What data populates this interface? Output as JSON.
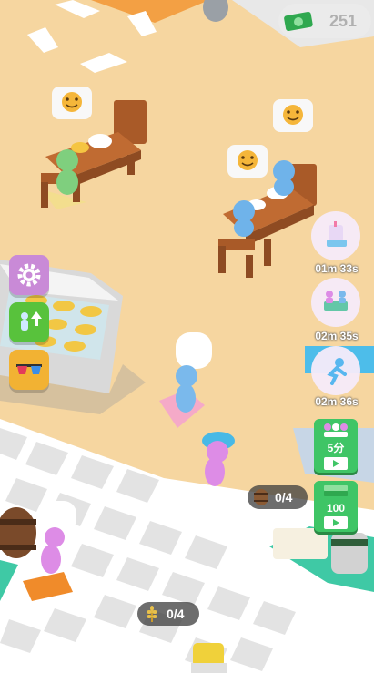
{
  "money": {
    "amount": "251",
    "icon": "cash-icon"
  },
  "hud_left": {
    "settings": {
      "icon": "gear-icon"
    },
    "upgrade": {
      "icon": "staff-upgrade-icon"
    },
    "boost": {
      "icon": "sunglasses-icon"
    }
  },
  "hud_right": {
    "boosts": [
      {
        "icon": "milkshake-boost-icon",
        "timer": "01m 33s"
      },
      {
        "icon": "staff-boost-icon",
        "timer": "02m 35s"
      },
      {
        "icon": "running-boost-icon",
        "timer": "02m 36s"
      }
    ],
    "ad_offers": [
      {
        "icon": "customers-icon",
        "label": "5分"
      },
      {
        "icon": "cash-stack-icon",
        "label": "100"
      }
    ]
  },
  "counters": {
    "barrel": {
      "icon": "barrel-icon",
      "value": "0/4"
    },
    "wheat": {
      "icon": "wheat-icon",
      "value": "0/4"
    }
  },
  "colors": {
    "floor": "#f6d6a0",
    "tile_light": "#ffffff",
    "tile_dark": "#e3e3e3",
    "table": "#b5602b",
    "accent_orange": "#f08b2a"
  }
}
